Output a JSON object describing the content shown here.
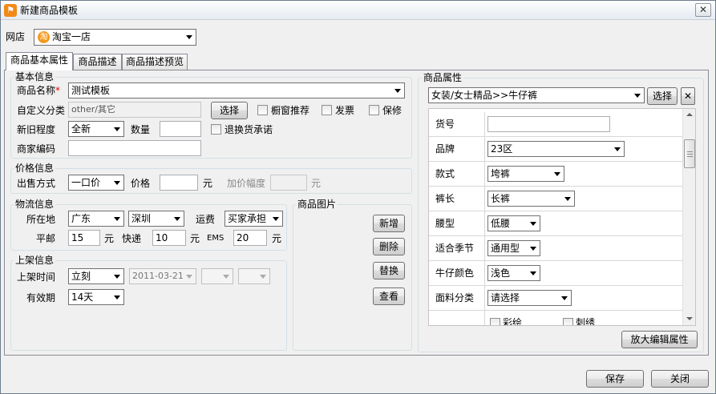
{
  "window": {
    "title": "新建商品模板",
    "close_glyph": "✕"
  },
  "shop": {
    "label": "网店",
    "value": "淘宝一店"
  },
  "tabs": [
    {
      "label": "商品基本属性"
    },
    {
      "label": "商品描述"
    },
    {
      "label": "商品描述预览"
    }
  ],
  "basic": {
    "group_title": "基本信息",
    "name_label": "商品名称",
    "name_required": "*",
    "name_value": "测试模板",
    "category_label": "自定义分类",
    "category_value": "other/其它",
    "choose_button": "选择",
    "showcase": "橱窗推荐",
    "invoice": "发票",
    "warranty": "保修",
    "condition_label": "新旧程度",
    "condition_value": "全新",
    "quantity_label": "数量",
    "quantity_value": "",
    "return_promise": "退换货承诺",
    "merchant_code_label": "商家编码",
    "merchant_code_value": ""
  },
  "price": {
    "group_title": "价格信息",
    "method_label": "出售方式",
    "method_value": "一口价",
    "price_label": "价格",
    "price_value": "",
    "price_unit": "元",
    "increment_label": "加价幅度",
    "increment_value": "",
    "increment_unit": "元"
  },
  "logistics": {
    "group_title": "物流信息",
    "location_label": "所在地",
    "province": "广东",
    "city": "深圳",
    "freight_label": "运费",
    "freight_value": "买家承担",
    "mail_label": "平邮",
    "mail_value": "15",
    "mail_unit": "元",
    "express_label": "快递",
    "express_value": "10",
    "express_unit": "元",
    "ems_label": "EMS",
    "ems_value": "20",
    "ems_unit": "元"
  },
  "listing": {
    "group_title": "上架信息",
    "time_label": "上架时间",
    "time_value": "立刻",
    "date_value": "2011-03-21",
    "hour_value": "",
    "minute_value": "",
    "validity_label": "有效期",
    "validity_value": "14天"
  },
  "images": {
    "group_title": "商品图片",
    "add": "新增",
    "delete": "删除",
    "replace": "替换",
    "view": "查看"
  },
  "attributes": {
    "group_title": "商品属性",
    "category_value": "女装/女士精品>>牛仔裤",
    "choose_button": "选择",
    "clear_glyph": "✕",
    "rows": [
      {
        "label": "货号",
        "value": ""
      },
      {
        "label": "品牌",
        "value": "23区"
      },
      {
        "label": "款式",
        "value": "垮裤"
      },
      {
        "label": "裤长",
        "value": "长裤"
      },
      {
        "label": "腰型",
        "value": "低腰"
      },
      {
        "label": "适合季节",
        "value": "通用型"
      },
      {
        "label": "牛仔颜色",
        "value": "浅色"
      },
      {
        "label": "面料分类",
        "value": "请选择"
      }
    ],
    "extra_options": [
      "彩绘",
      "刺绣"
    ],
    "enlarge_button": "放大编辑属性"
  },
  "footer": {
    "save": "保存",
    "close": "关闭"
  }
}
